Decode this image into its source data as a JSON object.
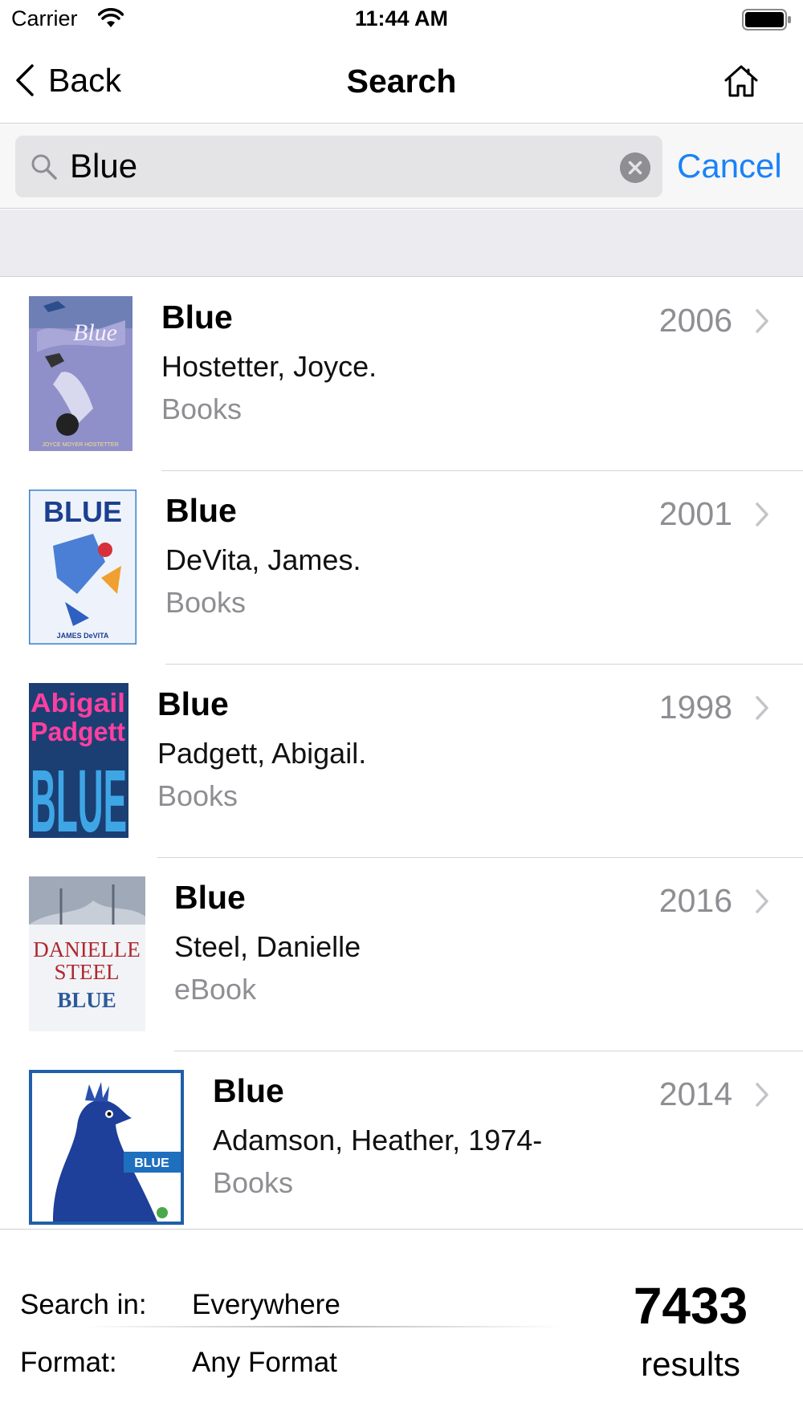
{
  "status_bar": {
    "carrier": "Carrier",
    "time": "11:44 AM"
  },
  "nav": {
    "back_label": "Back",
    "title": "Search",
    "home_icon": "home-icon"
  },
  "search": {
    "value": "Blue",
    "cancel_label": "Cancel"
  },
  "colors": {
    "accent": "#1a82f7",
    "secondary_text": "#8e8e93",
    "separator": "#d5d5d9",
    "band": "#ececf0"
  },
  "results": [
    {
      "title": "Blue",
      "author": "Hostetter, Joyce.",
      "format": "Books",
      "year": "2006",
      "cover_text": "JOYCE MOYER HOSTETTER"
    },
    {
      "title": "Blue",
      "author": "DeVita, James.",
      "format": "Books",
      "year": "2001",
      "cover_text": "JAMES DeVITA"
    },
    {
      "title": "Blue",
      "author": "Padgett, Abigail.",
      "format": "Books",
      "year": "1998",
      "cover_text": "Abigail Padgett BLUE"
    },
    {
      "title": "Blue",
      "author": "Steel, Danielle",
      "format": "eBook",
      "year": "2016",
      "cover_text": "DANIELLE STEEL BLUE"
    },
    {
      "title": "Blue",
      "author": "Adamson, Heather, 1974-",
      "format": "Books",
      "year": "2014",
      "cover_text": "BLUE"
    }
  ],
  "footer": {
    "search_in_label": "Search in:",
    "search_in_value": "Everywhere",
    "format_label": "Format:",
    "format_value": "Any Format",
    "result_count": "7433",
    "result_label": "results"
  }
}
